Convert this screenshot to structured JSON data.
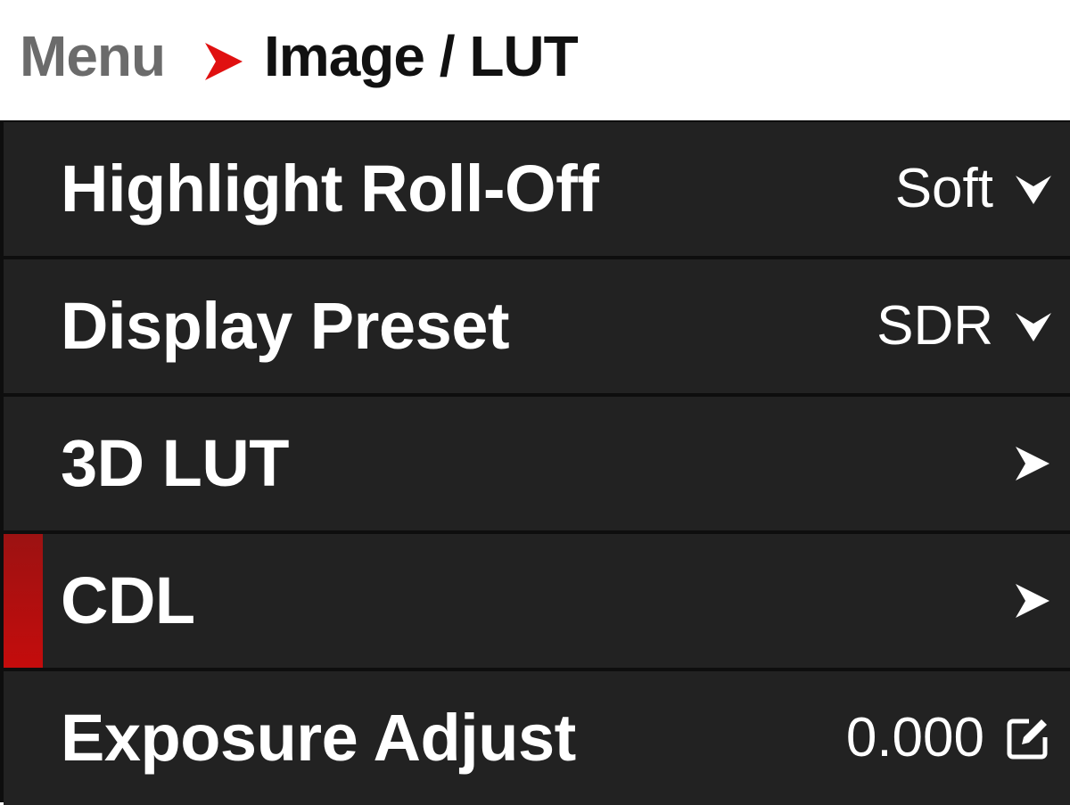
{
  "breadcrumb": {
    "parent": "Menu",
    "current": "Image / LUT",
    "separator_icon": "chevron-right-icon",
    "separator_color": "#e01010"
  },
  "menu": {
    "items": [
      {
        "label": "Highlight Roll-Off",
        "value": "Soft",
        "control": "dropdown",
        "icon": "chevron-down-icon",
        "selected": false
      },
      {
        "label": "Display Preset",
        "value": "SDR",
        "control": "dropdown",
        "icon": "chevron-down-icon",
        "selected": false
      },
      {
        "label": "3D LUT",
        "value": "",
        "control": "submenu",
        "icon": "chevron-right-icon",
        "selected": false
      },
      {
        "label": "CDL",
        "value": "",
        "control": "submenu",
        "icon": "chevron-right-icon",
        "selected": true
      },
      {
        "label": "Exposure Adjust",
        "value": "0.000",
        "control": "edit",
        "icon": "edit-icon",
        "selected": false
      }
    ]
  },
  "colors": {
    "row_background": "#222222",
    "divider": "#0e0e0e",
    "selection_accent": "#c40c0c",
    "text": "#ffffff"
  }
}
